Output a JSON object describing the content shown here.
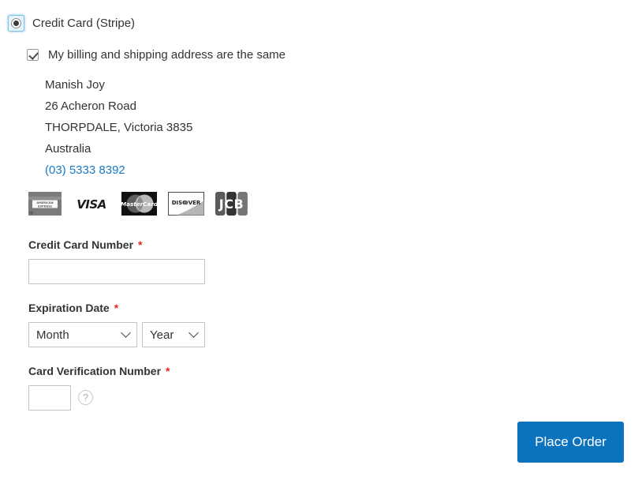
{
  "payment_method": {
    "label": "Credit Card (Stripe)",
    "selected": true,
    "radio_icon": "radio-selected-icon"
  },
  "billing": {
    "checkbox_label": "My billing and shipping address are the same",
    "checked": true,
    "address": {
      "name": "Manish Joy",
      "street": "26 Acheron Road",
      "city_line": "THORPDALE, Victoria 3835",
      "country": "Australia",
      "phone": "(03) 5333 8392"
    }
  },
  "accepted_cards": [
    {
      "name": "american-express-logo",
      "label": "AMERICAN EXPRESS"
    },
    {
      "name": "visa-logo",
      "label": "VISA"
    },
    {
      "name": "mastercard-logo",
      "label": "MasterCard"
    },
    {
      "name": "discover-logo",
      "label": "DISCOVER"
    },
    {
      "name": "jcb-logo",
      "label": "JCB"
    }
  ],
  "form": {
    "card_number": {
      "label": "Credit Card Number",
      "required_marker": "*",
      "value": "",
      "placeholder": ""
    },
    "expiration": {
      "label": "Expiration Date",
      "required_marker": "*",
      "month_value": "Month",
      "year_value": "Year"
    },
    "cvv": {
      "label": "Card Verification Number",
      "required_marker": "*",
      "value": "",
      "placeholder": "",
      "help_icon": "question-mark-icon",
      "help_glyph": "?"
    }
  },
  "actions": {
    "place_order_label": "Place Order"
  },
  "colors": {
    "primary_button": "#0b72bd",
    "link": "#1979c3",
    "required_asterisk": "#e02b27",
    "text": "#333333",
    "input_border": "#c2c2c2"
  }
}
